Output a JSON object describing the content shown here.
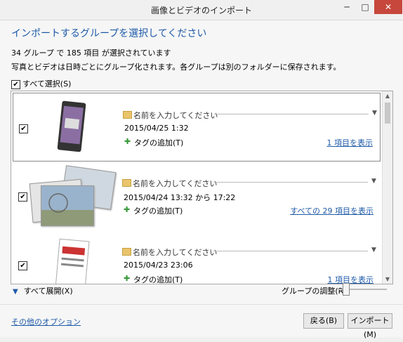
{
  "window": {
    "title": "画像とビデオのインポート",
    "min": "─",
    "max": "□",
    "close": "✕"
  },
  "heading": "インポートするグループを選択してください",
  "count_text": "34 グループ で 185 項目 が選択されています",
  "description": "写真とビデオは日時ごとにグループ化されます。各グループは別のフォルダーに保存されます。",
  "select_all": {
    "label": "すべて選択(S)",
    "checked": true,
    "mark": "✔"
  },
  "groups": [
    {
      "name_placeholder": "名前を入力してください",
      "date": "2015/04/25 1:32",
      "tag": "タグの追加(T)",
      "link": "1 項目を表示",
      "checked": true,
      "mark": "✔"
    },
    {
      "name_placeholder": "名前を入力してください",
      "date": "2015/04/24  13:32 から 17:22",
      "tag": "タグの追加(T)",
      "link": "すべての 29 項目を表示",
      "checked": true,
      "mark": "✔"
    },
    {
      "name_placeholder": "名前を入力してください",
      "date": "2015/04/23 23:06",
      "tag": "タグの追加(T)",
      "link": "1 項目を表示",
      "checked": true,
      "mark": "✔"
    }
  ],
  "expand_all": "すべて展開(X)",
  "group_adjust": "グループの調整(R):",
  "other_options": "その他のオプション",
  "buttons": {
    "back": "戻る(B)",
    "import": "インポート(M)"
  },
  "icons": {
    "expand": "chevron-down-icon",
    "folder": "folder-icon",
    "tag": "tag-add-icon",
    "dropdown": "dropdown-arrow-icon"
  },
  "colors": {
    "accent": "#1e5aa8",
    "close": "#c7473c"
  }
}
